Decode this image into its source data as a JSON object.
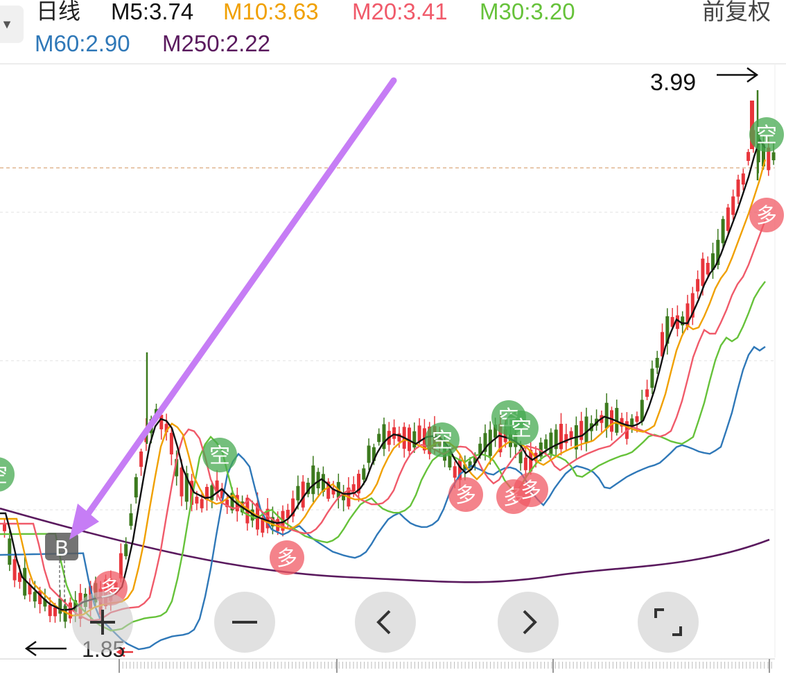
{
  "header": {
    "title": "日线",
    "adjust_label": "前复权",
    "moving_averages": [
      {
        "label": "M5:3.74",
        "color": "#111111"
      },
      {
        "label": "M10:3.63",
        "color": "#f0a000"
      },
      {
        "label": "M20:3.41",
        "color": "#f05a6a"
      },
      {
        "label": "M30:3.20",
        "color": "#66c23a"
      },
      {
        "label": "M60:2.90",
        "color": "#2f78b8"
      },
      {
        "label": "M250:2.22",
        "color": "#5a1a5e"
      }
    ]
  },
  "chart": {
    "high_label": "3.99",
    "low_label": "1.85",
    "buy_marker": "B",
    "sell_signal": "空",
    "buy_signal": "多",
    "colors": {
      "up": "#e8353b",
      "down": "#3c7a1e",
      "arrow": "#c67df5"
    }
  },
  "controls": [
    {
      "name": "zoom-in-button",
      "icon": "plus-icon"
    },
    {
      "name": "zoom-out-button",
      "icon": "minus-icon"
    },
    {
      "name": "scroll-left-button",
      "icon": "chevron-left-icon"
    },
    {
      "name": "scroll-right-button",
      "icon": "chevron-right-icon"
    },
    {
      "name": "fullscreen-button",
      "icon": "fullscreen-icon"
    }
  ]
}
